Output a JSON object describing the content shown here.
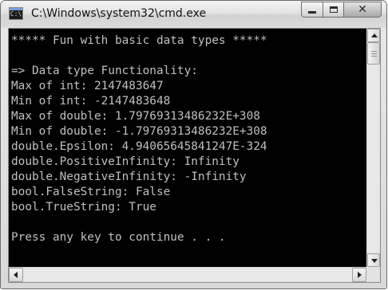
{
  "window": {
    "title": "C:\\Windows\\system32\\cmd.exe",
    "icon_text": "C:\\"
  },
  "controls": {
    "minimize": "minimize-icon",
    "maximize": "maximize-icon",
    "close": "close-icon",
    "close_glyph": "✕"
  },
  "console": {
    "foreground": "#c0c0c0",
    "background": "#000000",
    "lines": [
      "***** Fun with basic data types *****",
      "",
      "=> Data type Functionality:",
      "Max of int: 2147483647",
      "Min of int: -2147483648",
      "Max of double: 1.79769313486232E+308",
      "Min of double: -1.79769313486232E+308",
      "double.Epsilon: 4.94065645841247E-324",
      "double.PositiveInfinity: Infinity",
      "double.NegativeInfinity: -Infinity",
      "bool.FalseString: False",
      "bool.TrueString: True",
      "",
      "Press any key to continue . . ."
    ]
  }
}
